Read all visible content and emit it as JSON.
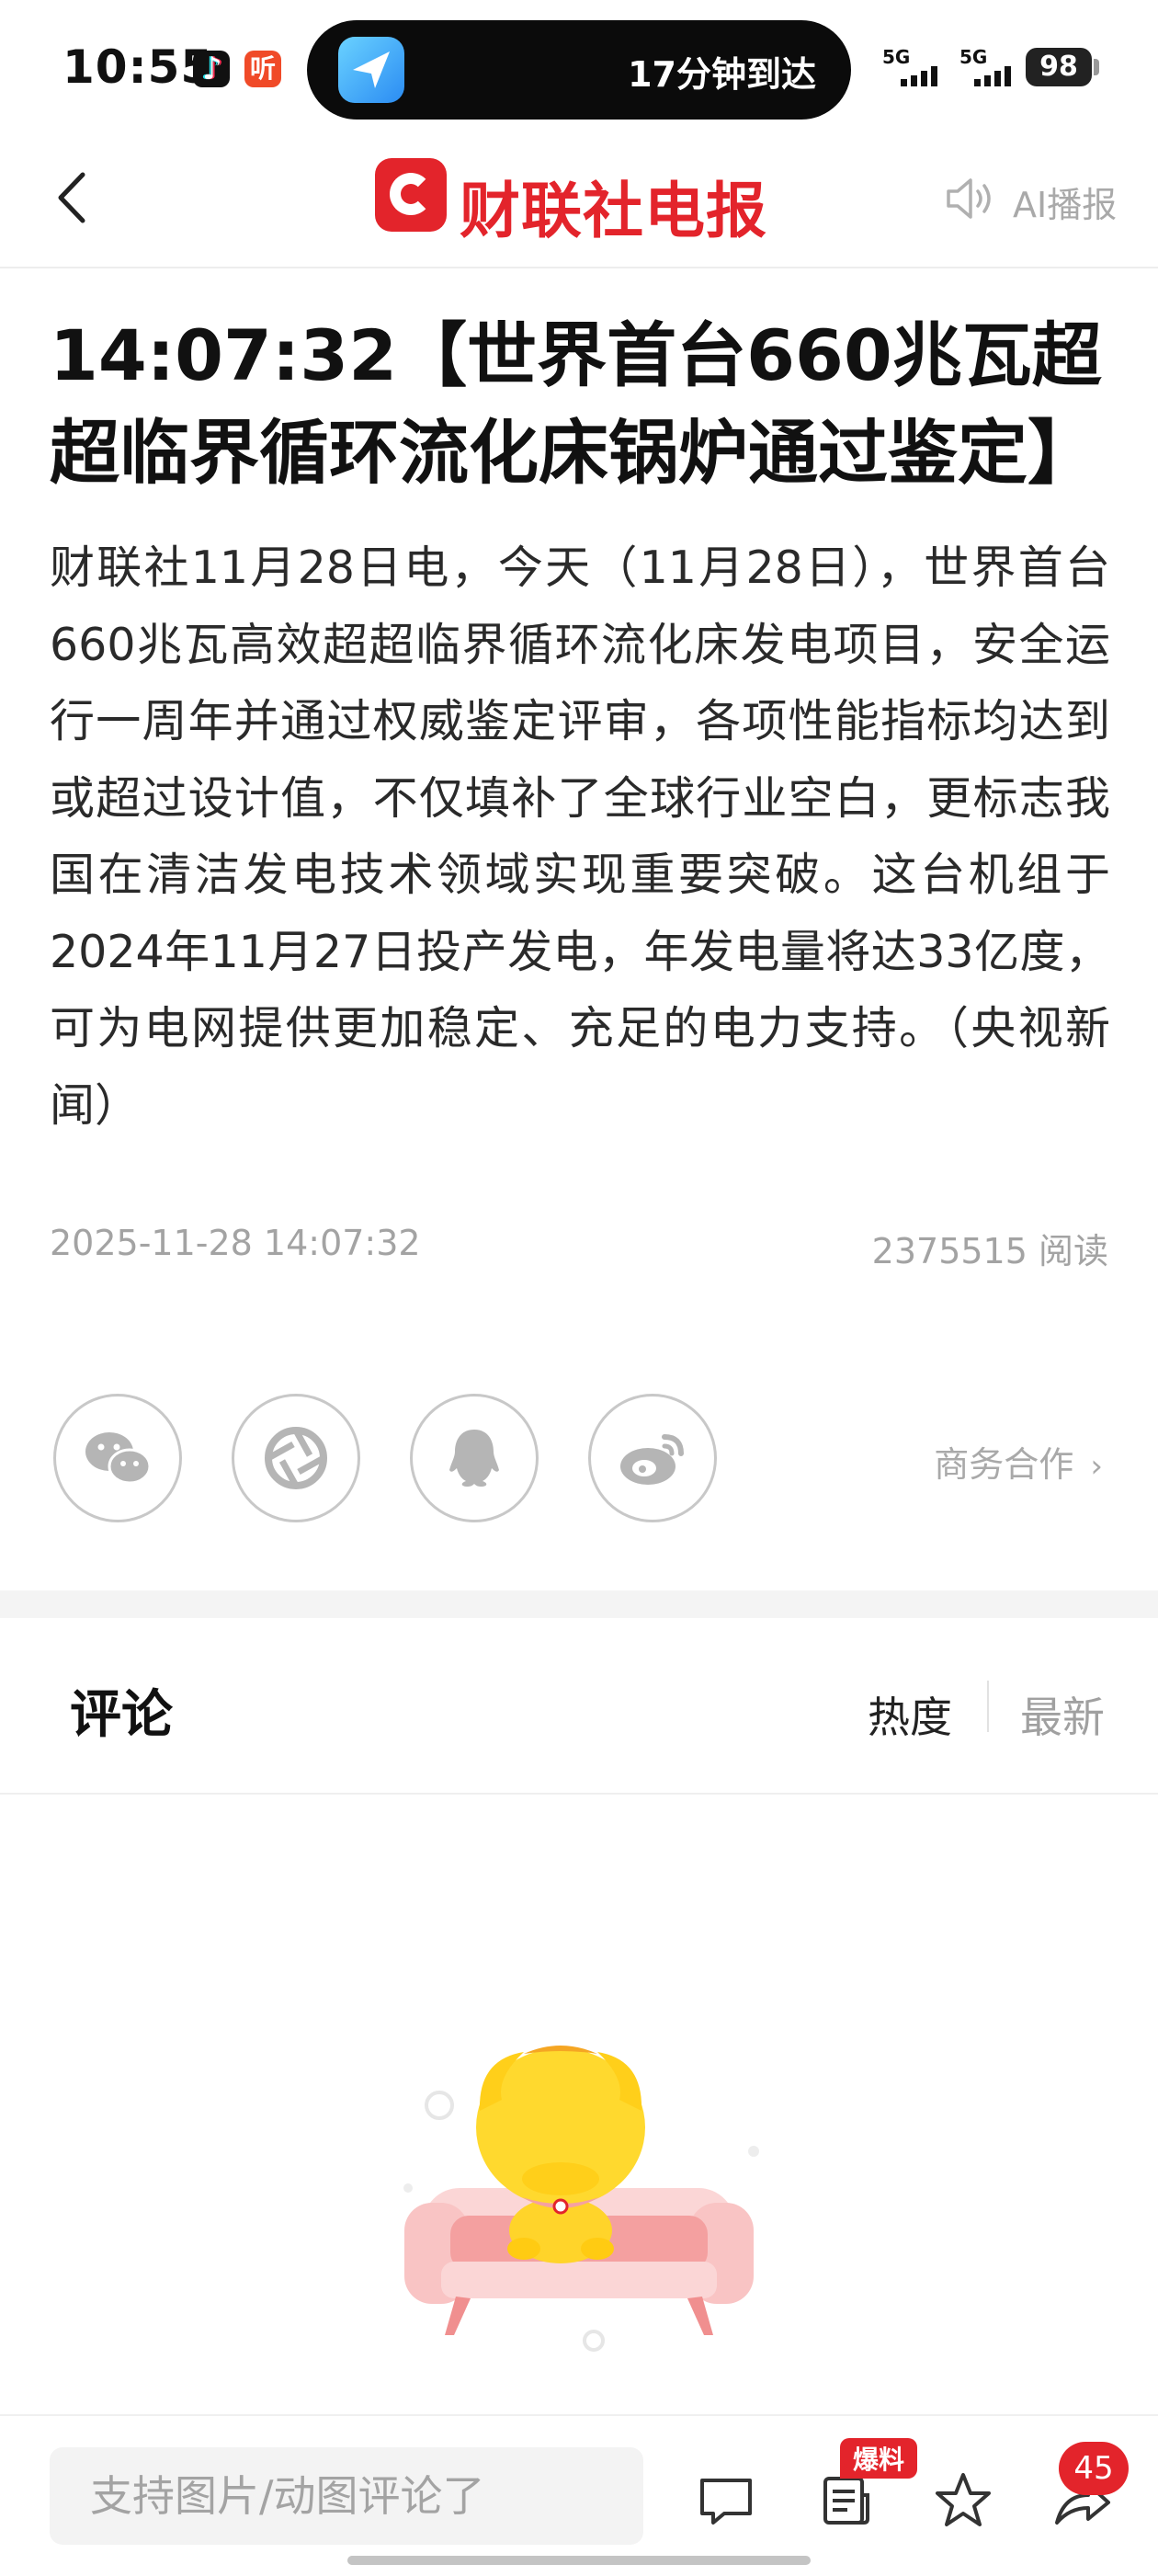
{
  "status_bar": {
    "time": "10:55",
    "app_icons": [
      "tiktok-icon",
      "ting-icon"
    ],
    "ting_label": "听",
    "island_text": "17分钟到达",
    "network_1": "5G",
    "network_2": "5G",
    "battery": "98"
  },
  "header": {
    "logo_text_a": "财联社",
    "logo_text_b": "电报",
    "ai_label": "AI播报",
    "brand_color": "#e3242b"
  },
  "article": {
    "title": "14:07:32【世界首台660兆瓦超超临界循环流化床锅炉通过鉴定】",
    "body": "财联社11月28日电，今天（11月28日），世界首台660兆瓦高效超超临界循环流化床发电项目，安全运行一周年并通过权威鉴定评审，各项性能指标均达到或超过设计值，不仅填补了全球行业空白，更标志我国在清洁发电技术领域实现重要突破。这台机组于2024年11月27日投产发电，年发电量将达33亿度，可为电网提供更加稳定、充足的电力支持。（央视新闻）",
    "date": "2025-11-28 14:07:32",
    "reads": "2375515 阅读"
  },
  "share": {
    "icons": [
      "wechat-icon",
      "moments-icon",
      "qq-icon",
      "weibo-icon"
    ],
    "business_label": "商务合作"
  },
  "comments": {
    "title": "评论",
    "sort_hot": "热度",
    "sort_new": "最新"
  },
  "bottom_bar": {
    "input_placeholder": "支持图片/动图评论了",
    "bao_badge": "爆料",
    "share_count": "45"
  }
}
